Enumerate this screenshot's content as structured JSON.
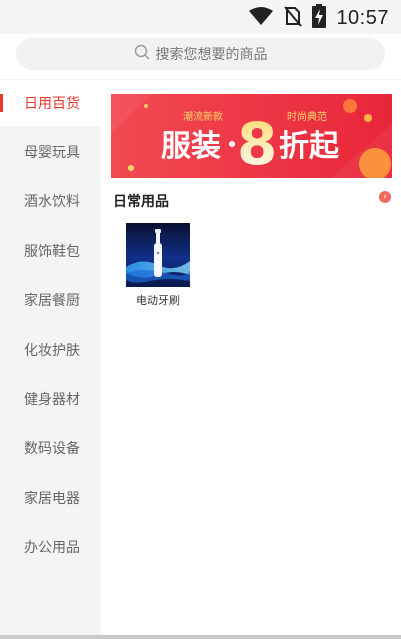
{
  "status_bar": {
    "time": "10:57",
    "icons": [
      "wifi-icon",
      "no-sim-icon",
      "battery-charging-icon"
    ]
  },
  "search": {
    "placeholder": "搜索您想要的商品",
    "icon": "search-icon"
  },
  "sidebar": {
    "items": [
      {
        "label": "日用百货",
        "active": true
      },
      {
        "label": "母婴玩具",
        "active": false
      },
      {
        "label": "酒水饮料",
        "active": false
      },
      {
        "label": "服饰鞋包",
        "active": false
      },
      {
        "label": "家居餐厨",
        "active": false
      },
      {
        "label": "化妆护肤",
        "active": false
      },
      {
        "label": "健身器材",
        "active": false
      },
      {
        "label": "数码设备",
        "active": false
      },
      {
        "label": "家居电器",
        "active": false
      },
      {
        "label": "办公用品",
        "active": false
      }
    ]
  },
  "banner": {
    "text_main": "服装",
    "number": "8",
    "text_suffix": "折起",
    "tag_left": "潮流新款",
    "tag_right": "时尚典范"
  },
  "section": {
    "title": "日常用品",
    "more_icon": "chevron-right-icon"
  },
  "products": [
    {
      "name": "电动牙刷",
      "image": "electric-toothbrush-image"
    }
  ],
  "colors": {
    "accent": "#e8382b",
    "sidebar_bg": "#f4f4f5",
    "banner_bg": "#ee3b3e"
  }
}
